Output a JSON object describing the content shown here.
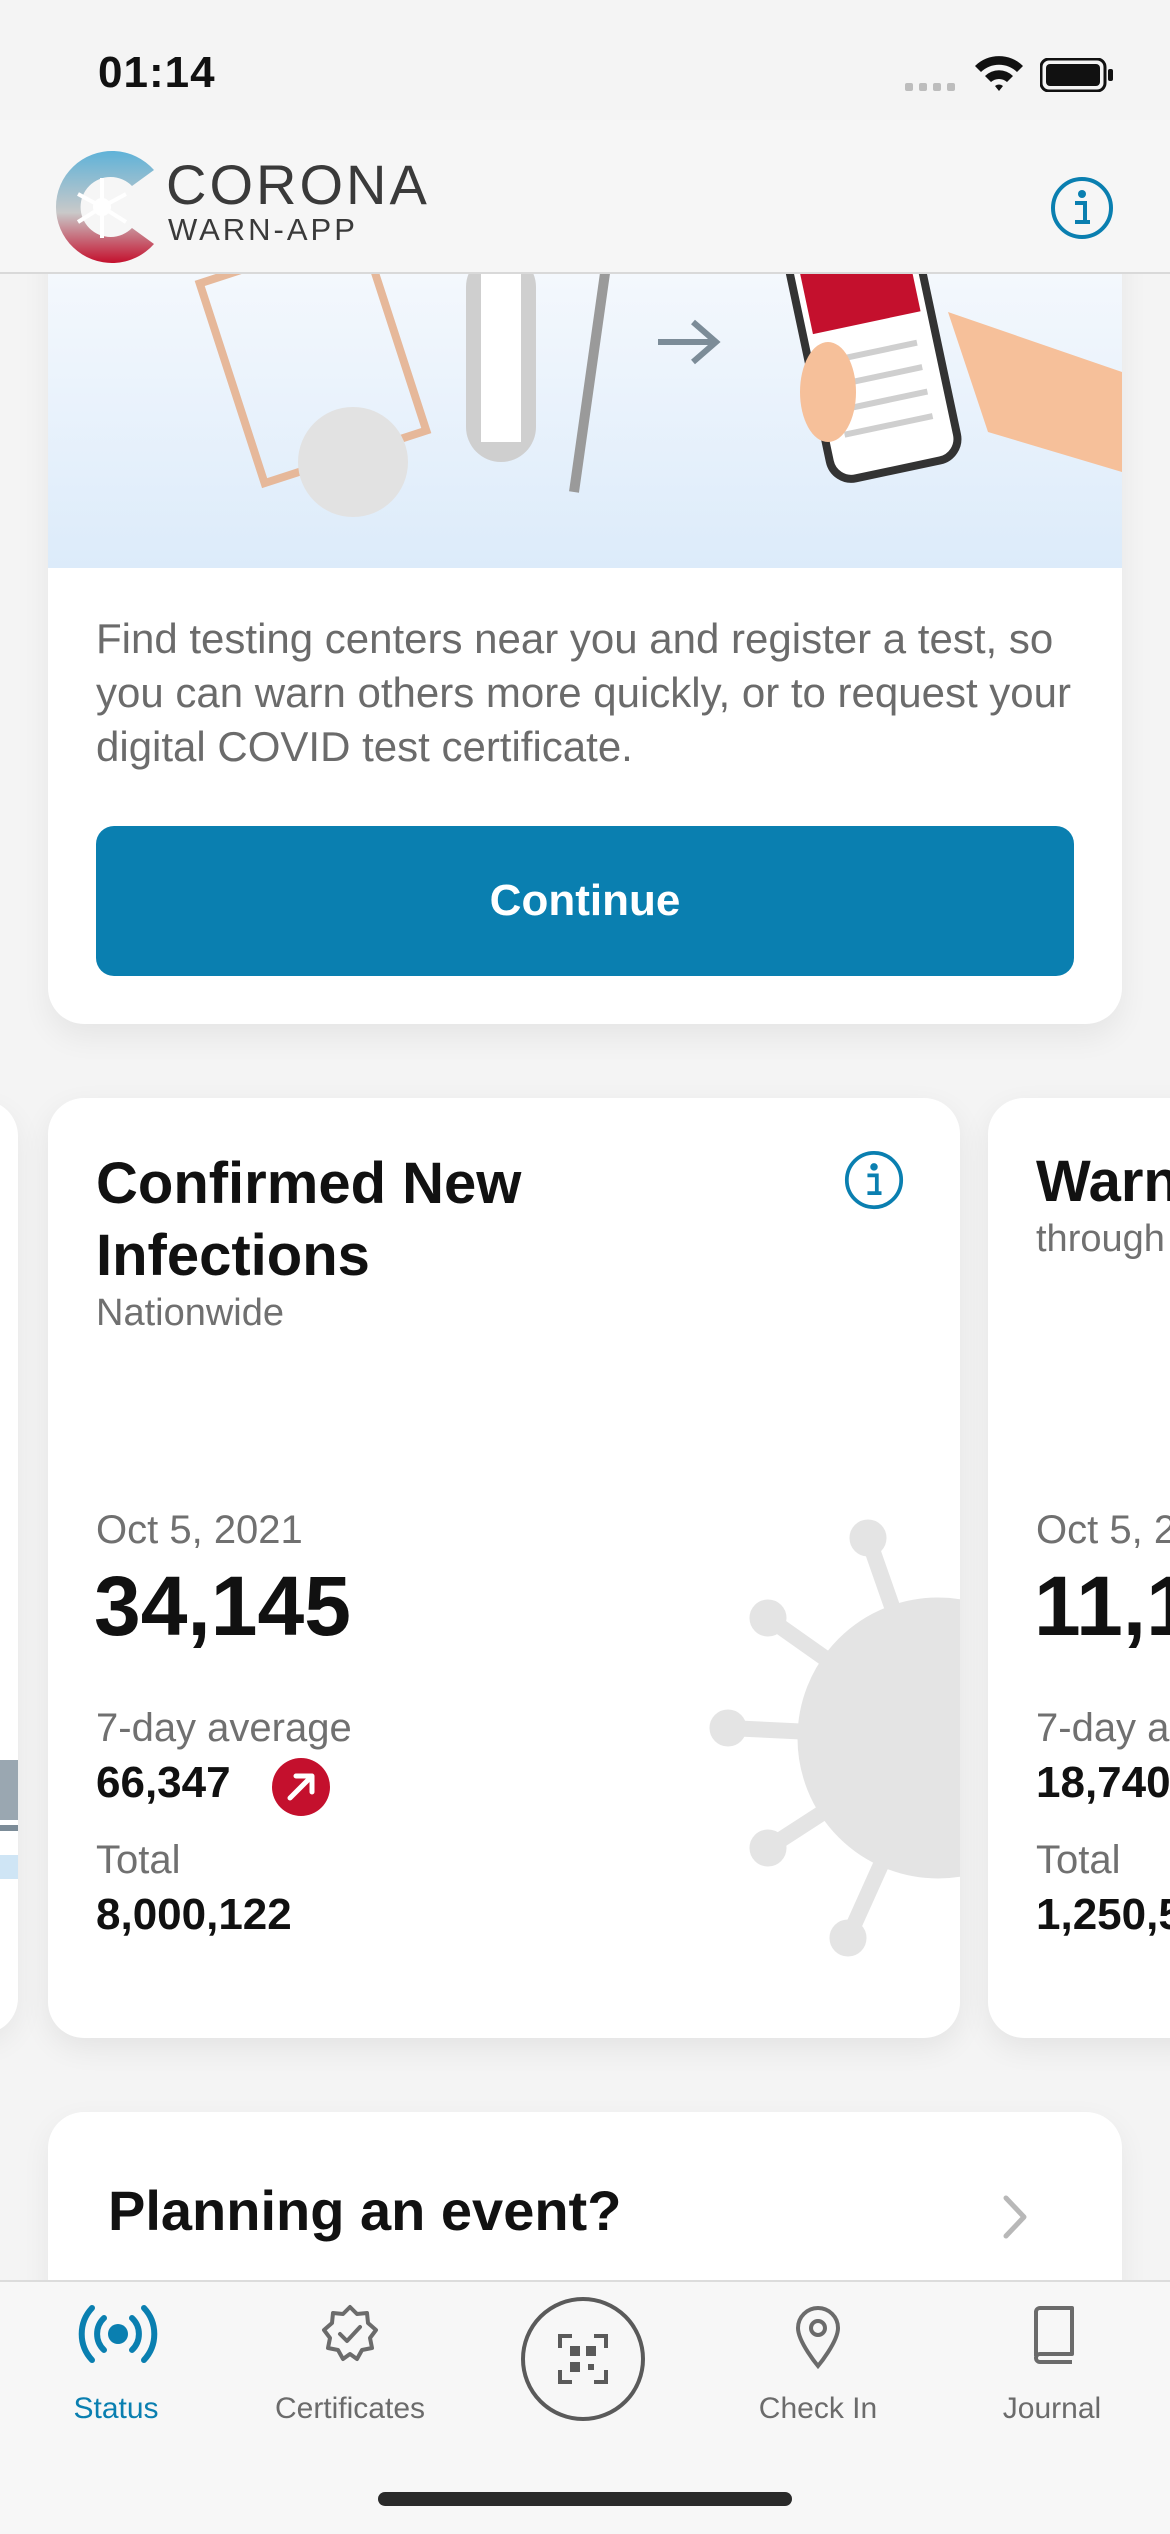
{
  "status_bar": {
    "time": "01:14"
  },
  "header": {
    "app_name_line1": "CORONA",
    "app_name_line2": "WARN-APP",
    "icons": [
      "logo-icon",
      "info-icon"
    ]
  },
  "test_card": {
    "description": "Find testing centers near you and register a test, so you can warn others more quickly, or to request your digital COVID test certificate.",
    "continue_label": "Continue"
  },
  "stats_card": {
    "title": "Confirmed New Infections",
    "subtitle": "Nationwide",
    "date": "Oct 5, 2021",
    "value": "34,145",
    "avg_label": "7-day average",
    "avg_value": "66,347",
    "total_label": "Total",
    "total_value": "8,000,122",
    "trend": "up",
    "trend_color": "#c4102d"
  },
  "next_stats_card": {
    "title": "Warn",
    "subtitle": "through",
    "date": "Oct 5, 2",
    "value": "11,1",
    "avg_label": "7-day a",
    "avg_value": "18,740",
    "total_label": "Total",
    "total_value": "1,250,5"
  },
  "event_card": {
    "title": "Planning an event?"
  },
  "tabs": [
    {
      "label": "Status",
      "icon": "broadcast-icon",
      "active": true
    },
    {
      "label": "Certificates",
      "icon": "certificate-icon",
      "active": false
    },
    {
      "label": "",
      "icon": "qr-scan-icon",
      "active": false
    },
    {
      "label": "Check In",
      "icon": "location-pin-icon",
      "active": false
    },
    {
      "label": "Journal",
      "icon": "book-icon",
      "active": false
    }
  ],
  "colors": {
    "accent": "#0a7fb0",
    "active_tab": "#0a7fb0",
    "trend": "#c4102d"
  }
}
